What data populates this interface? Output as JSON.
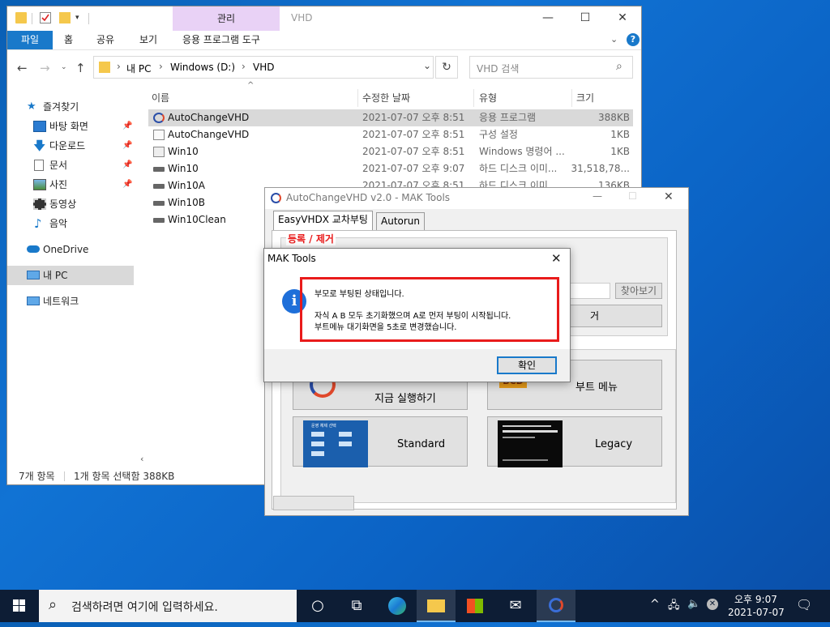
{
  "explorer": {
    "context_tab": "관리",
    "window_title": "VHD",
    "ribbon_tabs": [
      "파일",
      "홈",
      "공유",
      "보기",
      "응용 프로그램 도구"
    ],
    "address": {
      "parts": [
        "내 PC",
        "Windows (D:)",
        "VHD"
      ]
    },
    "search_placeholder": "VHD 검색",
    "nav": {
      "quick_access": "즐겨찾기",
      "items": [
        "바탕 화면",
        "다운로드",
        "문서",
        "사진",
        "동영상",
        "음악"
      ],
      "onedrive": "OneDrive",
      "this_pc": "내 PC",
      "network": "네트워크"
    },
    "columns": {
      "name": "이름",
      "date": "수정한 날짜",
      "type": "유형",
      "size": "크기"
    },
    "files": [
      {
        "name": "AutoChangeVHD",
        "date": "2021-07-07 오후 8:51",
        "type": "응용 프로그램",
        "size": "388KB"
      },
      {
        "name": "AutoChangeVHD",
        "date": "2021-07-07 오후 8:51",
        "type": "구성 설정",
        "size": "1KB"
      },
      {
        "name": "Win10",
        "date": "2021-07-07 오후 8:51",
        "type": "Windows 명령어 ...",
        "size": "1KB"
      },
      {
        "name": "Win10",
        "date": "2021-07-07 오후 9:07",
        "type": "하드 디스크 이미...",
        "size": "31,518,78..."
      },
      {
        "name": "Win10A",
        "date": "2021-07-07 오후 8:51",
        "type": "하드 디스크 이미...",
        "size": "136KB"
      },
      {
        "name": "Win10B",
        "date": "",
        "type": "",
        "size": ""
      },
      {
        "name": "Win10Clean",
        "date": "",
        "type": "",
        "size": ""
      }
    ],
    "status": {
      "count": "7개 항목",
      "selected": "1개 항목 선택함 388KB"
    }
  },
  "mak": {
    "title": "AutoChangeVHD v2.0 - MAK Tools",
    "tabs": [
      "EasyVHDX 교차부팅",
      "Autorun"
    ],
    "section": "등록 / 제거",
    "browse": "찾아보기",
    "remove_partial": "거",
    "buttons": {
      "run": "지금 실행하기",
      "boot_menu": "부트 메뉴",
      "standard": "Standard",
      "legacy": "Legacy"
    },
    "standard_thumb_title": "운영 체제 선택"
  },
  "dialog": {
    "title": "MAK Tools",
    "line1": "부모로 부팅된 상태입니다.",
    "line2": "자식 A B 모두 초기화했으며 A로 먼저 부팅이 시작됩니다.",
    "line3": "부트메뉴 대기화면을 5초로 변경했습니다.",
    "ok": "확인"
  },
  "taskbar": {
    "search_placeholder": "검색하려면 여기에 입력하세요.",
    "time": "오후 9:07",
    "date": "2021-07-07"
  },
  "colors": {
    "accent": "#1979ca",
    "highlight": "#e91b1b",
    "selection": "#cce8ff"
  }
}
